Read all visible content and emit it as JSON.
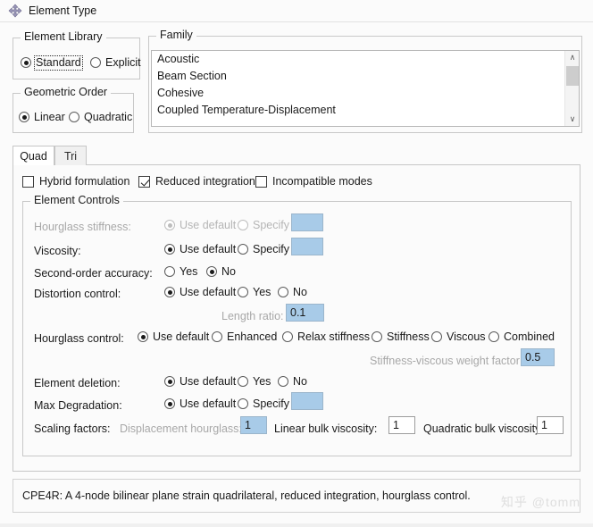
{
  "window": {
    "title": "Element Type",
    "icon": "four-way-arrow-icon"
  },
  "element_library": {
    "title": "Element Library",
    "options": [
      {
        "label": "Standard",
        "selected": true,
        "focused": true
      },
      {
        "label": "Explicit",
        "selected": false,
        "focused": false
      }
    ]
  },
  "geometric_order": {
    "title": "Geometric Order",
    "options": [
      {
        "label": "Linear",
        "selected": true
      },
      {
        "label": "Quadratic",
        "selected": false
      }
    ]
  },
  "family": {
    "title": "Family",
    "items": [
      "Acoustic",
      "Beam Section",
      "Cohesive",
      "Coupled Temperature-Displacement"
    ],
    "scrollbar": {
      "up_arrow": "∧",
      "down_arrow": "∨"
    }
  },
  "tabs": [
    {
      "label": "Quad",
      "active": true
    },
    {
      "label": "Tri",
      "active": false
    }
  ],
  "formulation_checks": [
    {
      "label": "Hybrid formulation",
      "checked": false
    },
    {
      "label": "Reduced integration",
      "checked": true
    },
    {
      "label": "Incompatible modes",
      "checked": false
    }
  ],
  "element_controls": {
    "title": "Element Controls",
    "hourglass_stiffness": {
      "label": "Hourglass stiffness:",
      "disabled": true,
      "options": [
        {
          "label": "Use default",
          "selected": true
        },
        {
          "label": "Specify",
          "selected": false
        }
      ],
      "value": ""
    },
    "viscosity": {
      "label": "Viscosity:",
      "disabled": false,
      "options": [
        {
          "label": "Use default",
          "selected": true
        },
        {
          "label": "Specify",
          "selected": false
        }
      ],
      "value": ""
    },
    "second_order_accuracy": {
      "label": "Second-order accuracy:",
      "options": [
        {
          "label": "Yes",
          "selected": false
        },
        {
          "label": "No",
          "selected": true
        }
      ]
    },
    "distortion_control": {
      "label": "Distortion control:",
      "options": [
        {
          "label": "Use default",
          "selected": true
        },
        {
          "label": "Yes",
          "selected": false
        },
        {
          "label": "No",
          "selected": false
        }
      ]
    },
    "length_ratio": {
      "label": "Length ratio:",
      "value": "0.1",
      "disabled": true
    },
    "hourglass_control": {
      "label": "Hourglass control:",
      "options": [
        {
          "label": "Use default",
          "selected": true
        },
        {
          "label": "Enhanced",
          "selected": false
        },
        {
          "label": "Relax stiffness",
          "selected": false
        },
        {
          "label": "Stiffness",
          "selected": false
        },
        {
          "label": "Viscous",
          "selected": false
        },
        {
          "label": "Combined",
          "selected": false
        }
      ]
    },
    "stiffness_viscous_weight_factor": {
      "label": "Stiffness-viscous weight factor:",
      "value": "0.5",
      "disabled": true
    },
    "element_deletion": {
      "label": "Element deletion:",
      "options": [
        {
          "label": "Use default",
          "selected": true
        },
        {
          "label": "Yes",
          "selected": false
        },
        {
          "label": "No",
          "selected": false
        }
      ]
    },
    "max_degradation": {
      "label": "Max Degradation:",
      "options": [
        {
          "label": "Use default",
          "selected": true
        },
        {
          "label": "Specify",
          "selected": false
        }
      ],
      "value": ""
    },
    "scaling_factors": {
      "label": "Scaling factors:",
      "displacement_hourglass": {
        "label": "Displacement hourglass:",
        "value": "1",
        "disabled": true
      },
      "linear_bulk_viscosity": {
        "label": "Linear bulk viscosity:",
        "value": "1",
        "disabled": false
      },
      "quadratic_bulk_viscosity": {
        "label": "Quadratic bulk viscosity:",
        "value": "1",
        "disabled": false
      }
    }
  },
  "description": "CPE4R:  A 4-node bilinear plane strain quadrilateral, reduced integration, hourglass control.",
  "watermark": "知乎 @tomm",
  "colors": {
    "field_blue": "#a8cbe8",
    "background": "#fbfbfb",
    "border": "#c8c8c8",
    "disabled_text": "#a8a8a8"
  }
}
